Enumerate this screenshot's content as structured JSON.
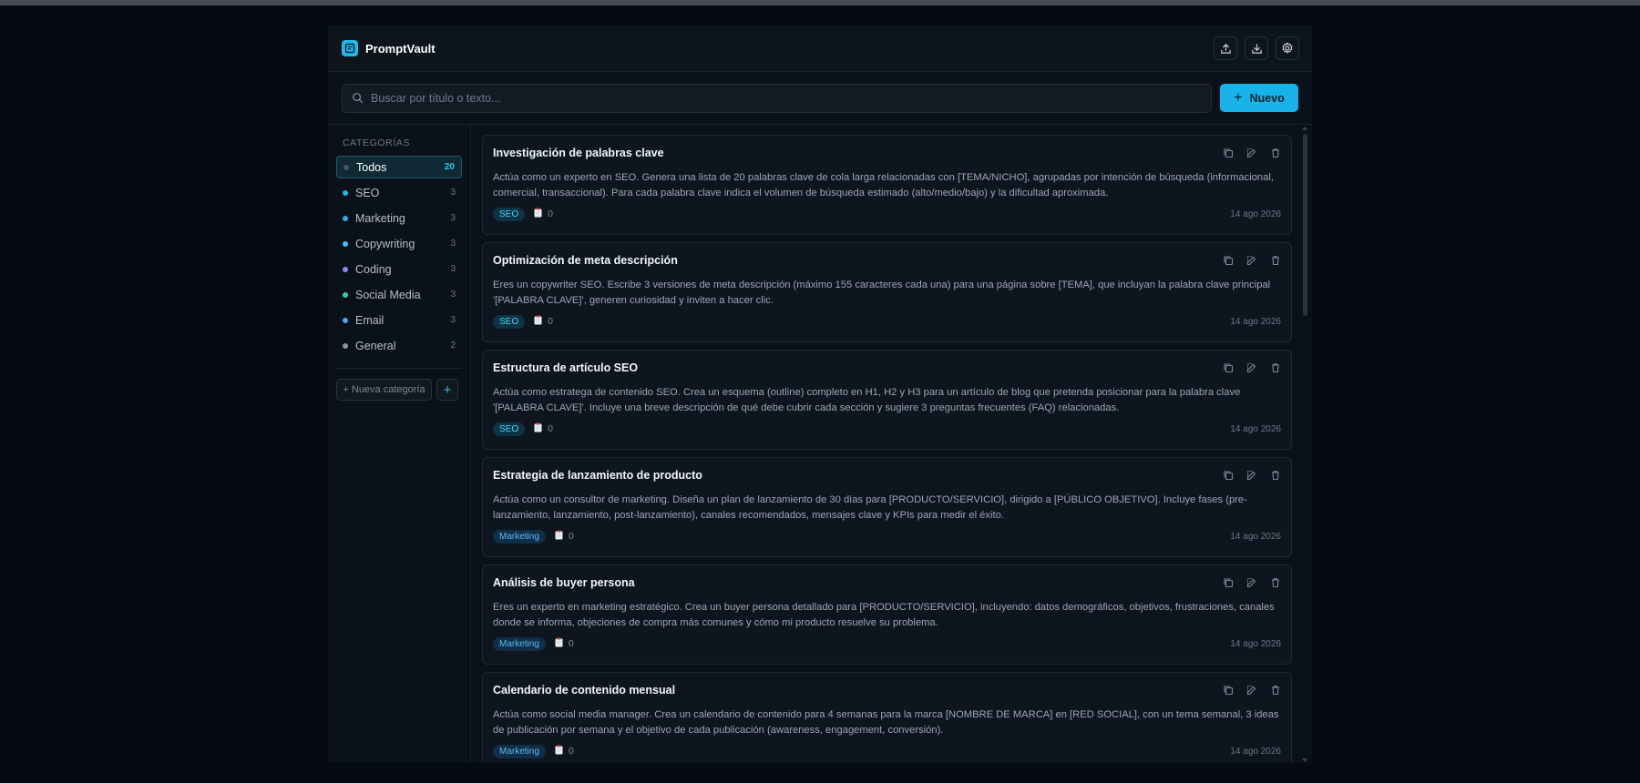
{
  "app": {
    "name": "PromptVault",
    "accent": "#17b3e8"
  },
  "search": {
    "placeholder": "Buscar por título o texto...",
    "value": ""
  },
  "new_button": {
    "label": "Nuevo"
  },
  "sidebar": {
    "title": "CATEGORÍAS",
    "categories": [
      {
        "name": "Todos",
        "count": "20",
        "color": "#4a5561",
        "active": true
      },
      {
        "name": "SEO",
        "count": "3",
        "color": "#22b9e9"
      },
      {
        "name": "Marketing",
        "count": "3",
        "color": "#38a9f0"
      },
      {
        "name": "Copywriting",
        "count": "3",
        "color": "#3fc0f2"
      },
      {
        "name": "Coding",
        "count": "3",
        "color": "#8c86f2"
      },
      {
        "name": "Social Media",
        "count": "3",
        "color": "#2fd0a8"
      },
      {
        "name": "Email",
        "count": "3",
        "color": "#4fa7f0"
      },
      {
        "name": "General",
        "count": "2",
        "color": "#8a96a3"
      }
    ],
    "new_category_label": "+ Nueva categoría",
    "add_label": "+"
  },
  "prompts": [
    {
      "title": "Investigación de palabras clave",
      "text": "Actúa como un experto en SEO. Genera una lista de 20 palabras clave de cola larga relacionadas con [TEMA/NICHO], agrupadas por intención de búsqueda (informacional, comercial, transaccional). Para cada palabra clave indica el volumen de búsqueda estimado (alto/medio/bajo) y la dificultad aproximada.",
      "tag": "SEO",
      "uses": "0",
      "date": "14 ago 2026"
    },
    {
      "title": "Optimización de meta descripción",
      "text": "Eres un copywriter SEO. Escribe 3 versiones de meta descripción (máximo 155 caracteres cada una) para una página sobre [TEMA], que incluyan la palabra clave principal '[PALABRA CLAVE]', generen curiosidad y inviten a hacer clic.",
      "tag": "SEO",
      "uses": "0",
      "date": "14 ago 2026"
    },
    {
      "title": "Estructura de artículo SEO",
      "text": "Actúa como estratega de contenido SEO. Crea un esquema (outline) completo en H1, H2 y H3 para un artículo de blog que pretenda posicionar para la palabra clave '[PALABRA CLAVE]'. Incluye una breve descripción de qué debe cubrir cada sección y sugiere 3 preguntas frecuentes (FAQ) relacionadas.",
      "tag": "SEO",
      "uses": "0",
      "date": "14 ago 2026"
    },
    {
      "title": "Estrategia de lanzamiento de producto",
      "text": "Actúa como un consultor de marketing. Diseña un plan de lanzamiento de 30 días para [PRODUCTO/SERVICIO], dirigido a [PÚBLICO OBJETIVO]. Incluye fases (pre-lanzamiento, lanzamiento, post-lanzamiento), canales recomendados, mensajes clave y KPIs para medir el éxito.",
      "tag": "Marketing",
      "uses": "0",
      "date": "14 ago 2026"
    },
    {
      "title": "Análisis de buyer persona",
      "text": "Eres un experto en marketing estratégico. Crea un buyer persona detallado para [PRODUCTO/SERVICIO], incluyendo: datos demográficos, objetivos, frustraciones, canales donde se informa, objeciones de compra más comunes y cómo mi producto resuelve su problema.",
      "tag": "Marketing",
      "uses": "0",
      "date": "14 ago 2026"
    },
    {
      "title": "Calendario de contenido mensual",
      "text": "Actúa como social media manager. Crea un calendario de contenido para 4 semanas para la marca [NOMBRE DE MARCA] en [RED SOCIAL], con un tema semanal, 3 ideas de publicación por semana y el objetivo de cada publicación (awareness, engagement, conversión).",
      "tag": "Marketing",
      "uses": "0",
      "date": "14 ago 2026"
    }
  ]
}
